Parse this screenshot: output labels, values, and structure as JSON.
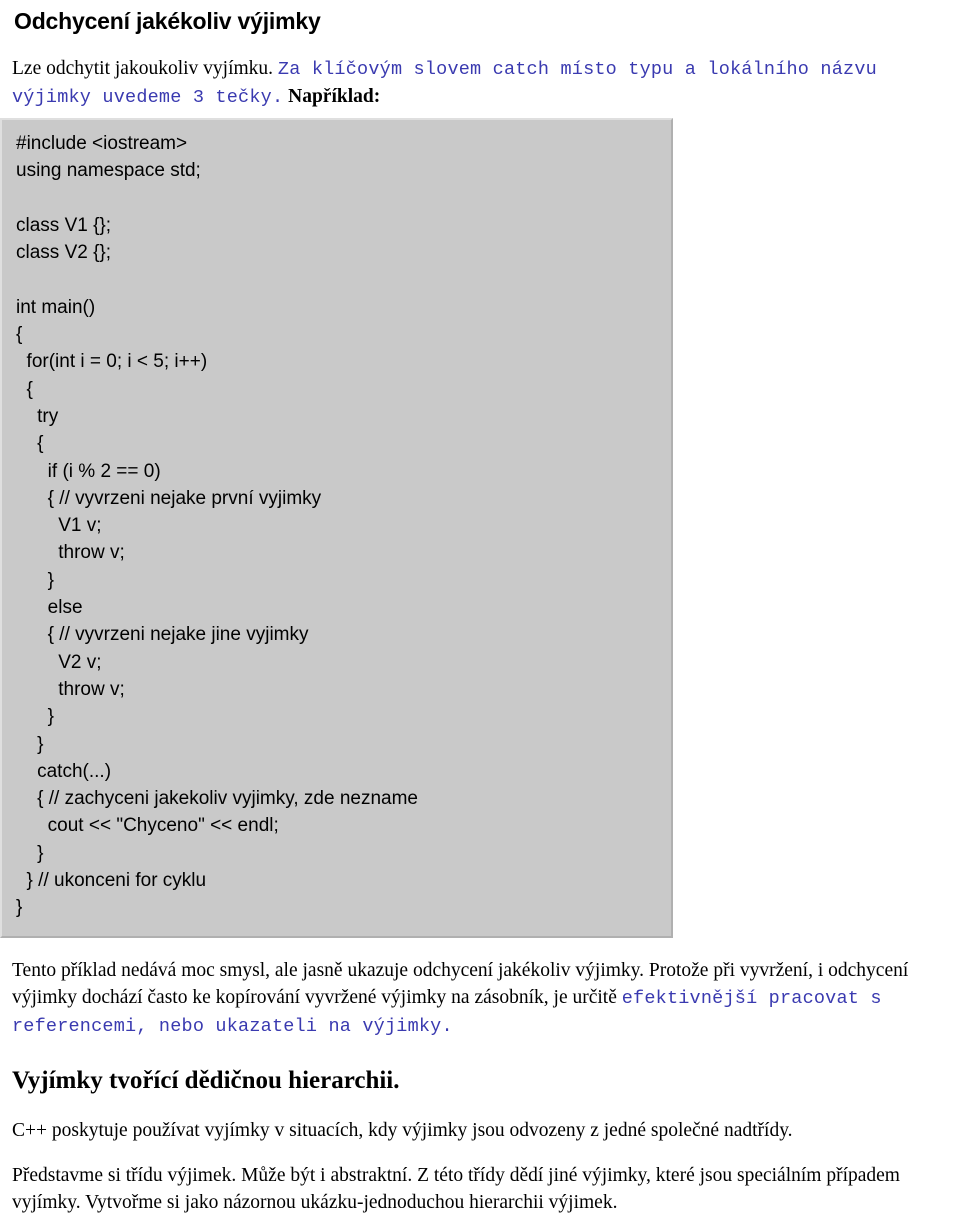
{
  "document": {
    "heading_1": "Odchycení jakékoliv výjimky",
    "intro_paragraph": {
      "plain_1": "Lze odchytit jakoukoliv vyjímku. ",
      "mono_1": "Za klíčovým slovem catch místo typu a lokálního názvu výjimky uvedeme 3 tečky.",
      "plain_2": " Například:"
    },
    "code_block": {
      "language_label": "C++",
      "background_color": "#c9c9c9",
      "lines": [
        "#include <iostream>",
        "using namespace std;",
        "",
        "class V1 {};",
        "class V2 {};",
        "",
        "int main()",
        "{",
        "  for(int i = 0; i < 5; i++)",
        "  {",
        "    try",
        "    {",
        "      if (i % 2 == 0)",
        "      { // vyvrzeni nejake první vyjimky",
        "        V1 v;",
        "        throw v;",
        "      }",
        "      else",
        "      { // vyvrzeni nejake jine vyjimky",
        "        V2 v;",
        "        throw v;",
        "      }",
        "    }",
        "    catch(...)",
        "    { // zachyceni jakekoliv vyjimky, zde nezname",
        "      cout << \"Chyceno\" << endl;",
        "    }",
        "  } // ukonceni for cyklu",
        "}"
      ]
    },
    "paragraph_2": {
      "plain_1": "Tento příklad nedává moc smysl, ale jasně ukazuje odchycení jakékoliv výjimky. Protože při vyvržení, i odchycení výjimky dochází často ke kopírování vyvržené výjimky na zásobník, je určitě ",
      "mono_1": "efektivnější pracovat s referencemi, nebo ukazateli na výjimky."
    },
    "heading_2": "Vyjímky tvořící dědičnou hierarchii.",
    "paragraph_3": "C++ poskytuje používat vyjímky v situacích, kdy výjimky jsou odvozeny z jedné společné nadtřídy.",
    "paragraph_4": "Představme si třídu výjimek. Může být i abstraktní. Z této třídy dědí jiné výjimky, které jsou speciálním případem vyjímky. Vytvořme si jako názornou ukázku-jednoduchou hierarchii výjimek."
  },
  "colors": {
    "text": "#000000",
    "mono_accent": "#3a3ab0",
    "code_bg": "#c9c9c9",
    "page_bg": "#ffffff"
  }
}
